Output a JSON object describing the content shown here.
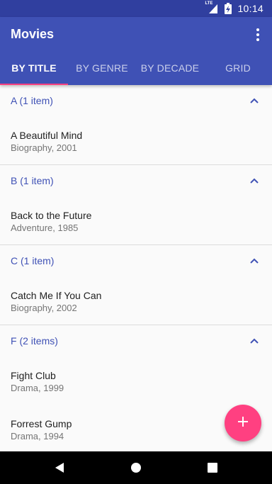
{
  "status_bar": {
    "network_label": "LTE",
    "time": "10:14",
    "icons": [
      "lte-signal-icon",
      "battery-charging-icon"
    ]
  },
  "app_bar": {
    "title": "Movies",
    "menu_icon": "overflow-menu-icon"
  },
  "tabs": [
    {
      "label": "BY TITLE",
      "selected": true
    },
    {
      "label": "BY GENRE",
      "selected": false
    },
    {
      "label": "BY DECADE",
      "selected": false
    },
    {
      "label": "GRID",
      "selected": false
    }
  ],
  "sections": [
    {
      "header": "A (1 item)",
      "expanded": true,
      "items": [
        {
          "title": "A Beautiful Mind",
          "subtitle": "Biography, 2001"
        }
      ]
    },
    {
      "header": "B (1 item)",
      "expanded": true,
      "items": [
        {
          "title": "Back to the Future",
          "subtitle": "Adventure, 1985"
        }
      ]
    },
    {
      "header": "C (1 item)",
      "expanded": true,
      "items": [
        {
          "title": "Catch Me If You Can",
          "subtitle": "Biography, 2002"
        }
      ]
    },
    {
      "header": "F (2 items)",
      "expanded": true,
      "items": [
        {
          "title": "Fight Club",
          "subtitle": "Drama, 1999"
        },
        {
          "title": "Forrest Gump",
          "subtitle": "Drama, 1994"
        }
      ]
    }
  ],
  "fab": {
    "icon": "add-icon"
  },
  "nav_bar": {
    "icons": [
      "back-icon",
      "home-icon",
      "recents-icon"
    ]
  },
  "colors": {
    "primary": "#3f51b5",
    "primary_dark": "#303f9f",
    "accent": "#ff4081"
  }
}
